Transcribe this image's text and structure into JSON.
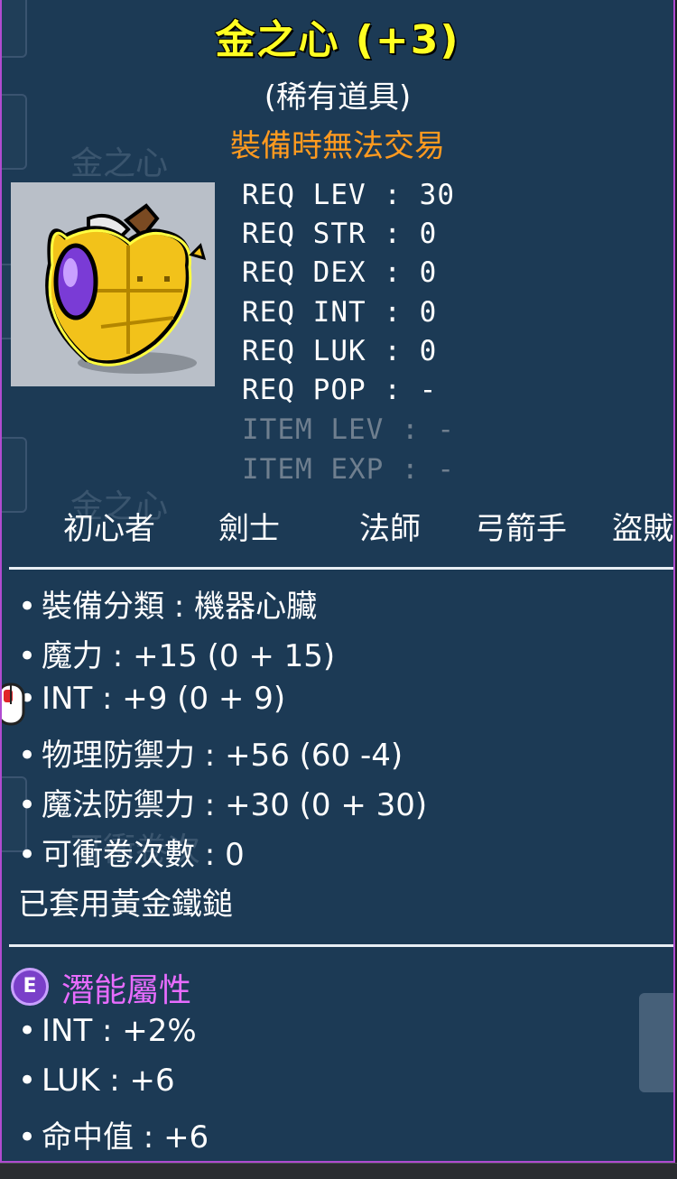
{
  "item": {
    "name": "金之心 (+3)",
    "rarity": "(稀有道具)",
    "trade_notice": "裝備時無法交易",
    "icon": "golden-heart-icon"
  },
  "requirements": [
    {
      "label": "REQ LEV",
      "value": "30"
    },
    {
      "label": "REQ STR",
      "value": "0"
    },
    {
      "label": "REQ DEX",
      "value": "0"
    },
    {
      "label": "REQ INT",
      "value": "0"
    },
    {
      "label": "REQ LUK",
      "value": "0"
    },
    {
      "label": "REQ POP",
      "value": "-"
    },
    {
      "label": "ITEM LEV",
      "value": "-"
    },
    {
      "label": "ITEM EXP",
      "value": "-"
    }
  ],
  "jobs": [
    "初心者",
    "劍士",
    "法師",
    "弓箭手",
    "盜賊"
  ],
  "stats": [
    "裝備分類 : 機器心臟",
    "魔力 : +15 (0 + 15)",
    "INT : +9 (0 + 9)",
    "物理防禦力 : +56 (60 -4)",
    "魔法防禦力 : +30 (0 + 30)",
    "可衝卷次數 : 0"
  ],
  "applied_note": "已套用黃金鐵鎚",
  "potential": {
    "badge": "E",
    "title": "潛能屬性",
    "lines": [
      "INT : +2%",
      "LUK : +6",
      "命中值 : +6"
    ]
  },
  "colors": {
    "title": "#ffff22",
    "trade": "#ff9a1f",
    "potential": "#e86cff",
    "panel": "#1c3a55",
    "border": "#b04bd0"
  }
}
